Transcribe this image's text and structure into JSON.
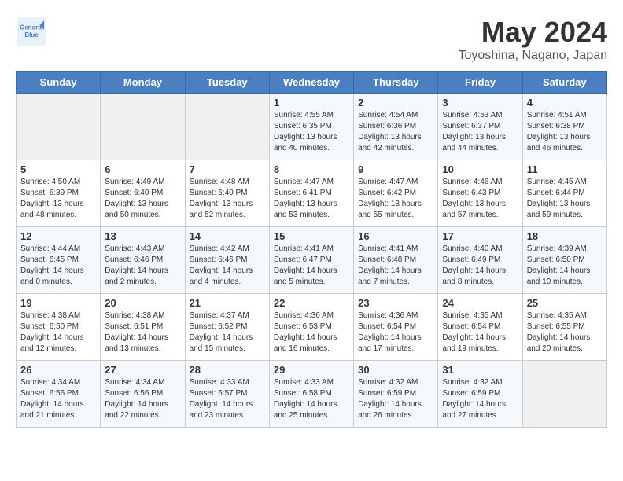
{
  "header": {
    "logo_line1": "General",
    "logo_line2": "Blue",
    "month_year": "May 2024",
    "location": "Toyoshina, Nagano, Japan"
  },
  "days_of_week": [
    "Sunday",
    "Monday",
    "Tuesday",
    "Wednesday",
    "Thursday",
    "Friday",
    "Saturday"
  ],
  "weeks": [
    [
      {
        "day": "",
        "content": ""
      },
      {
        "day": "",
        "content": ""
      },
      {
        "day": "",
        "content": ""
      },
      {
        "day": "1",
        "content": "Sunrise: 4:55 AM\nSunset: 6:35 PM\nDaylight: 13 hours\nand 40 minutes."
      },
      {
        "day": "2",
        "content": "Sunrise: 4:54 AM\nSunset: 6:36 PM\nDaylight: 13 hours\nand 42 minutes."
      },
      {
        "day": "3",
        "content": "Sunrise: 4:53 AM\nSunset: 6:37 PM\nDaylight: 13 hours\nand 44 minutes."
      },
      {
        "day": "4",
        "content": "Sunrise: 4:51 AM\nSunset: 6:38 PM\nDaylight: 13 hours\nand 46 minutes."
      }
    ],
    [
      {
        "day": "5",
        "content": "Sunrise: 4:50 AM\nSunset: 6:39 PM\nDaylight: 13 hours\nand 48 minutes."
      },
      {
        "day": "6",
        "content": "Sunrise: 4:49 AM\nSunset: 6:40 PM\nDaylight: 13 hours\nand 50 minutes."
      },
      {
        "day": "7",
        "content": "Sunrise: 4:48 AM\nSunset: 6:40 PM\nDaylight: 13 hours\nand 52 minutes."
      },
      {
        "day": "8",
        "content": "Sunrise: 4:47 AM\nSunset: 6:41 PM\nDaylight: 13 hours\nand 53 minutes."
      },
      {
        "day": "9",
        "content": "Sunrise: 4:47 AM\nSunset: 6:42 PM\nDaylight: 13 hours\nand 55 minutes."
      },
      {
        "day": "10",
        "content": "Sunrise: 4:46 AM\nSunset: 6:43 PM\nDaylight: 13 hours\nand 57 minutes."
      },
      {
        "day": "11",
        "content": "Sunrise: 4:45 AM\nSunset: 6:44 PM\nDaylight: 13 hours\nand 59 minutes."
      }
    ],
    [
      {
        "day": "12",
        "content": "Sunrise: 4:44 AM\nSunset: 6:45 PM\nDaylight: 14 hours\nand 0 minutes."
      },
      {
        "day": "13",
        "content": "Sunrise: 4:43 AM\nSunset: 6:46 PM\nDaylight: 14 hours\nand 2 minutes."
      },
      {
        "day": "14",
        "content": "Sunrise: 4:42 AM\nSunset: 6:46 PM\nDaylight: 14 hours\nand 4 minutes."
      },
      {
        "day": "15",
        "content": "Sunrise: 4:41 AM\nSunset: 6:47 PM\nDaylight: 14 hours\nand 5 minutes."
      },
      {
        "day": "16",
        "content": "Sunrise: 4:41 AM\nSunset: 6:48 PM\nDaylight: 14 hours\nand 7 minutes."
      },
      {
        "day": "17",
        "content": "Sunrise: 4:40 AM\nSunset: 6:49 PM\nDaylight: 14 hours\nand 8 minutes."
      },
      {
        "day": "18",
        "content": "Sunrise: 4:39 AM\nSunset: 6:50 PM\nDaylight: 14 hours\nand 10 minutes."
      }
    ],
    [
      {
        "day": "19",
        "content": "Sunrise: 4:38 AM\nSunset: 6:50 PM\nDaylight: 14 hours\nand 12 minutes."
      },
      {
        "day": "20",
        "content": "Sunrise: 4:38 AM\nSunset: 6:51 PM\nDaylight: 14 hours\nand 13 minutes."
      },
      {
        "day": "21",
        "content": "Sunrise: 4:37 AM\nSunset: 6:52 PM\nDaylight: 14 hours\nand 15 minutes."
      },
      {
        "day": "22",
        "content": "Sunrise: 4:36 AM\nSunset: 6:53 PM\nDaylight: 14 hours\nand 16 minutes."
      },
      {
        "day": "23",
        "content": "Sunrise: 4:36 AM\nSunset: 6:54 PM\nDaylight: 14 hours\nand 17 minutes."
      },
      {
        "day": "24",
        "content": "Sunrise: 4:35 AM\nSunset: 6:54 PM\nDaylight: 14 hours\nand 19 minutes."
      },
      {
        "day": "25",
        "content": "Sunrise: 4:35 AM\nSunset: 6:55 PM\nDaylight: 14 hours\nand 20 minutes."
      }
    ],
    [
      {
        "day": "26",
        "content": "Sunrise: 4:34 AM\nSunset: 6:56 PM\nDaylight: 14 hours\nand 21 minutes."
      },
      {
        "day": "27",
        "content": "Sunrise: 4:34 AM\nSunset: 6:56 PM\nDaylight: 14 hours\nand 22 minutes."
      },
      {
        "day": "28",
        "content": "Sunrise: 4:33 AM\nSunset: 6:57 PM\nDaylight: 14 hours\nand 23 minutes."
      },
      {
        "day": "29",
        "content": "Sunrise: 4:33 AM\nSunset: 6:58 PM\nDaylight: 14 hours\nand 25 minutes."
      },
      {
        "day": "30",
        "content": "Sunrise: 4:32 AM\nSunset: 6:59 PM\nDaylight: 14 hours\nand 26 minutes."
      },
      {
        "day": "31",
        "content": "Sunrise: 4:32 AM\nSunset: 6:59 PM\nDaylight: 14 hours\nand 27 minutes."
      },
      {
        "day": "",
        "content": ""
      }
    ]
  ]
}
